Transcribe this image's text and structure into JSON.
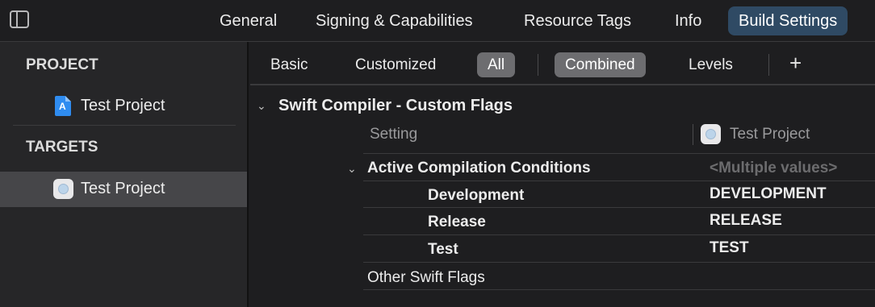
{
  "top_tabs": [
    "General",
    "Signing & Capabilities",
    "Resource Tags",
    "Info",
    "Build Settings"
  ],
  "active_tab": "Build Settings",
  "sidebar": {
    "project_heading": "PROJECT",
    "project_item": {
      "label": "Test Project",
      "icon": "project-document-icon"
    },
    "targets_heading": "TARGETS",
    "target_item": {
      "label": "Test Project",
      "icon": "app-target-icon"
    }
  },
  "filters": {
    "basic": "Basic",
    "customized": "Customized",
    "all": "All",
    "combined": "Combined",
    "levels": "Levels",
    "add": "+"
  },
  "group": {
    "title": "Swift Compiler - Custom Flags",
    "header_setting": "Setting",
    "header_target": "Test Project"
  },
  "rows": {
    "active": {
      "name": "Active Compilation Conditions",
      "value": "<Multiple values>"
    },
    "development": {
      "name": "Development",
      "value": "DEVELOPMENT"
    },
    "release": {
      "name": "Release",
      "value": "RELEASE"
    },
    "test": {
      "name": "Test",
      "value": "TEST"
    },
    "other": {
      "name": "Other Swift Flags",
      "value": ""
    }
  },
  "colors": {
    "active_tab_bg": "#2f4a64",
    "toggle_on_bg": "#6d6d70",
    "selected_row_bg": "#464649"
  }
}
